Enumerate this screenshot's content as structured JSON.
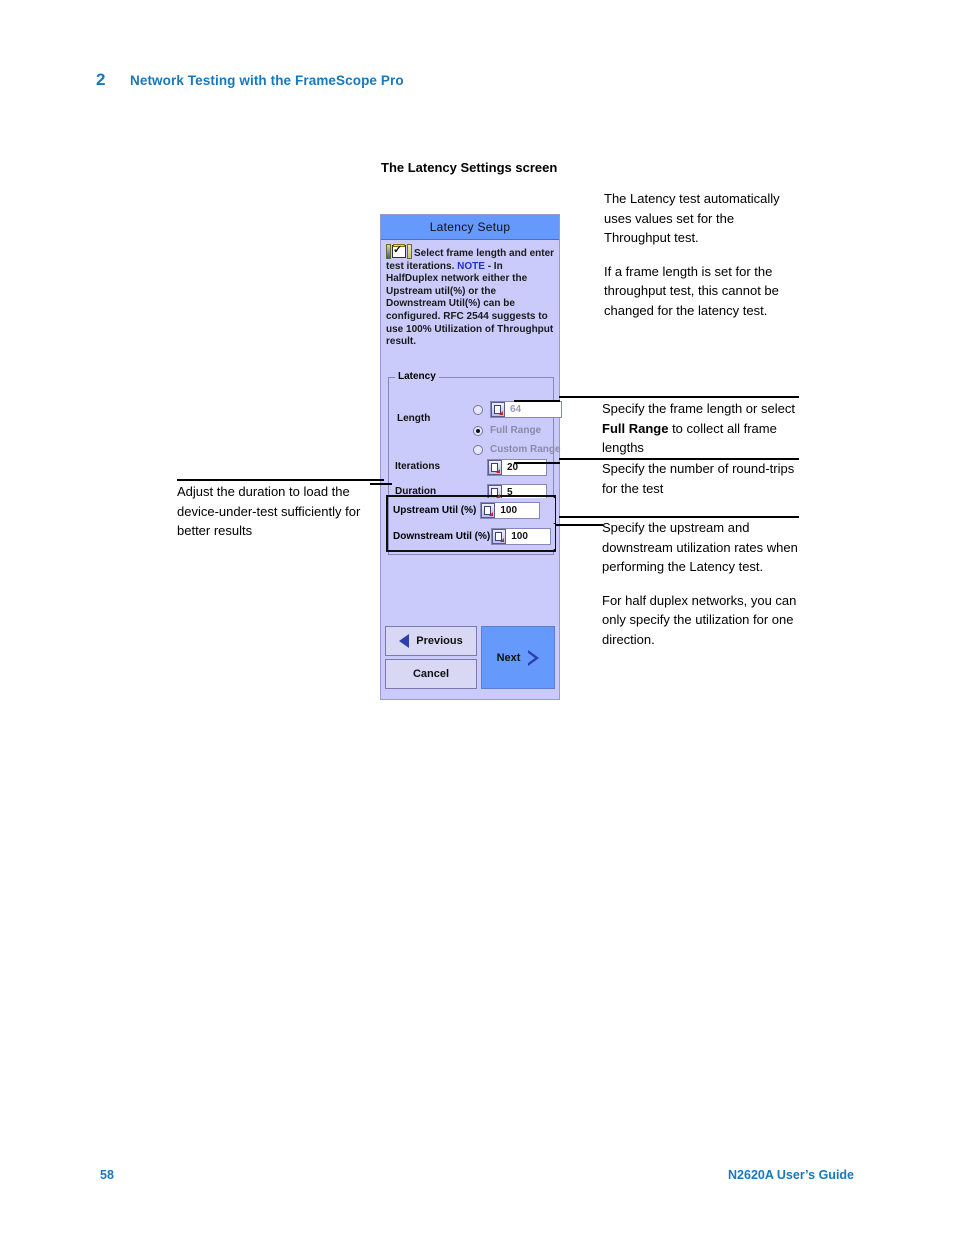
{
  "header": {
    "chapter_number": "2",
    "chapter_title": "Network Testing with the FrameScope Pro"
  },
  "section_heading": "The Latency Settings screen",
  "dialog": {
    "title": "Latency Setup",
    "note": {
      "line1": "Select frame length and",
      "line2": "enter test iterations.",
      "note_label": "NOTE",
      "body": "- In HalfDuplex network either the Upstream util(%) or the Downstream Util(%) can be configured. RFC 2544 suggests to use 100% Utilization of Throughput result."
    },
    "group_legend": "Latency",
    "fields": {
      "length_label": "Length",
      "length_value": "64",
      "full_range_label": "Full Range",
      "custom_range_label": "Custom Range",
      "iterations_label": "Iterations",
      "iterations_value": "20",
      "duration_label": "Duration",
      "duration_value": "5",
      "upstream_label": "Upstream Util (%)",
      "upstream_value": "100",
      "downstream_label": "Downstream Util (%)",
      "downstream_value": "100"
    },
    "buttons": {
      "previous": "Previous",
      "cancel": "Cancel",
      "next": "Next"
    },
    "colors": {
      "titlebar": "#6699fc",
      "background": "#cbcbfb",
      "next_button": "#6699fc",
      "note_keyword": "#1a33cc"
    }
  },
  "annotations": {
    "top_right": {
      "p1": "The Latency test automatically uses values set for the Throughput test.",
      "p2": "If a frame length is set for the throughput test, this cannot be changed for the latency test."
    },
    "frame_length": {
      "part1": "Specify the frame length or select ",
      "bold": "Full Range",
      "part2": " to collect all frame lengths"
    },
    "iterations": {
      "p1": "Specify the number of round-trips for the test"
    },
    "utilization": {
      "p1": "Specify the upstream and downstream utilization rates when performing the Latency test.",
      "p2": "For half duplex networks, you can only specify the utilization for one direction."
    },
    "duration_left": {
      "p1": "Adjust the duration to load the device-under-test sufficiently for better results"
    }
  },
  "footer": {
    "page_number": "58",
    "guide_title": "N2620A User’s Guide"
  }
}
